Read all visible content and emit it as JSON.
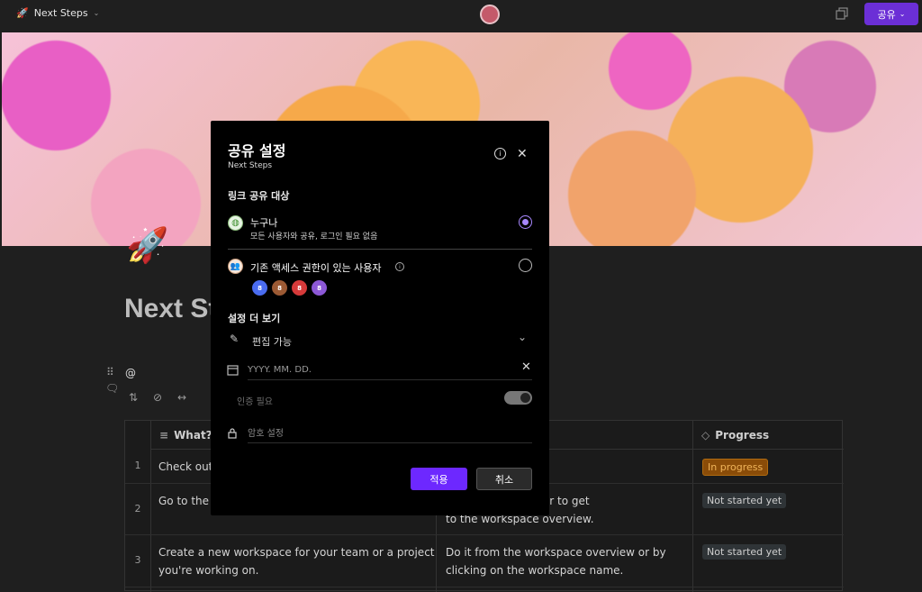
{
  "topbar": {
    "title": "Next Steps",
    "share_label": "공유"
  },
  "page": {
    "title": "Next Steps",
    "mention_symbol": "@"
  },
  "table": {
    "headers": [
      "What?",
      "Progress"
    ],
    "rows": [
      {
        "num": "1",
        "what": "Check out",
        "how": "",
        "progress": "In progress"
      },
      {
        "num": "2",
        "what": "Go to the w",
        "how_line1": "n the top left corner to get",
        "how_line2": "to the workspace overview.",
        "progress": "Not started yet"
      },
      {
        "num": "3",
        "what_line1": "Create a new workspace for your team or a project",
        "what_line2": "you're working on.",
        "how_line1": "Do it from the workspace overview or by",
        "how_line2": "clicking on the workspace name.",
        "progress": "Not started yet"
      }
    ]
  },
  "dialog": {
    "title": "공유 설정",
    "subtitle": "Next Steps",
    "section_link": "링크 공유 대상",
    "option_anyone_title": "누구나",
    "option_anyone_desc": "모든 사용자와 공유, 로그인 필요 없음",
    "option_existing_title": "기존 액세스 권한이 있는 사용자",
    "avatar_labels": [
      "8",
      "8",
      "8",
      "8"
    ],
    "section_more": "설정 더 보기",
    "permission_value": "편집 가능",
    "date_placeholder": "YYYY. MM. DD.",
    "auth_label": "인증 필요",
    "password_label": "암호 설정",
    "apply_label": "적용",
    "cancel_label": "취소"
  },
  "colors": {
    "accent": "#6d28ff",
    "radio_on": "#a888ff",
    "tag_in_progress": "#c06d0f",
    "tag_not_started": "#2f3437"
  }
}
